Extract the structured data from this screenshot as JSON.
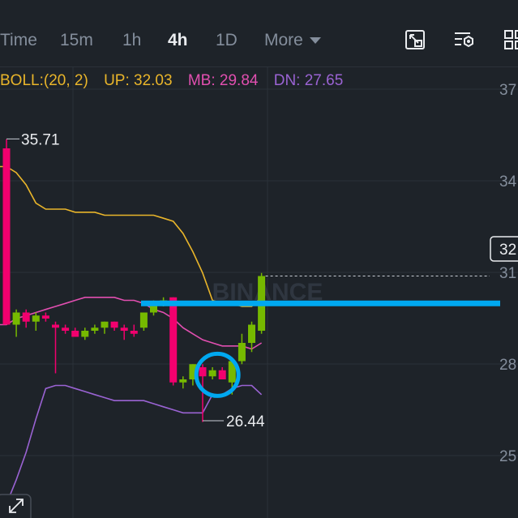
{
  "toolbar": {
    "timeframes": [
      "Time",
      "15m",
      "1h",
      "4h",
      "1D"
    ],
    "active": "4h",
    "more_label": "More",
    "tools": [
      "fullscreen-icon",
      "indicator-settings-icon",
      "layout-grid-icon"
    ]
  },
  "indicator": {
    "name": "BOLL:(20, 2)",
    "up": "UP: 32.03",
    "mb": "MB: 29.84",
    "dn": "DN: 27.65"
  },
  "colors": {
    "background": "#1e2329",
    "up_candle": "#76b900",
    "down_candle": "#f2006e",
    "upper_band": "#e9b52a",
    "middle_band": "#e14fb0",
    "lower_band": "#9a63d3",
    "annotation_line": "#00a8f0",
    "axis_text": "#848e9c"
  },
  "chart_data": {
    "type": "candlestick",
    "watermark": "BINANCE",
    "y_axis_labels": [
      "37",
      "34",
      "31",
      "28",
      "25"
    ],
    "current_price_label": "32",
    "high_marker": "35.71",
    "low_marker": "26.44",
    "candles": [
      {
        "o": 35.4,
        "h": 35.7,
        "l": 29.6,
        "c": 29.6
      },
      {
        "o": 29.6,
        "h": 30.1,
        "l": 29.2,
        "c": 30.0
      },
      {
        "o": 30.0,
        "h": 30.1,
        "l": 29.5,
        "c": 29.7
      },
      {
        "o": 29.7,
        "h": 30.0,
        "l": 29.4,
        "c": 29.9
      },
      {
        "o": 29.9,
        "h": 30.0,
        "l": 29.7,
        "c": 29.8
      },
      {
        "o": 29.6,
        "h": 29.7,
        "l": 28.0,
        "c": 29.5
      },
      {
        "o": 29.5,
        "h": 29.6,
        "l": 29.3,
        "c": 29.4
      },
      {
        "o": 29.4,
        "h": 29.5,
        "l": 29.2,
        "c": 29.2
      },
      {
        "o": 29.2,
        "h": 29.5,
        "l": 29.1,
        "c": 29.4
      },
      {
        "o": 29.4,
        "h": 29.6,
        "l": 29.3,
        "c": 29.5
      },
      {
        "o": 29.5,
        "h": 29.7,
        "l": 29.3,
        "c": 29.7
      },
      {
        "o": 29.7,
        "h": 29.7,
        "l": 29.4,
        "c": 29.5
      },
      {
        "o": 29.5,
        "h": 29.6,
        "l": 29.1,
        "c": 29.4
      },
      {
        "o": 29.4,
        "h": 29.6,
        "l": 29.2,
        "c": 29.3
      },
      {
        "o": 29.5,
        "h": 30.0,
        "l": 29.4,
        "c": 30.0
      },
      {
        "o": 30.0,
        "h": 30.4,
        "l": 29.9,
        "c": 30.3
      },
      {
        "o": 30.3,
        "h": 30.5,
        "l": 30.2,
        "c": 30.4
      },
      {
        "o": 30.5,
        "h": 30.5,
        "l": 27.6,
        "c": 27.7
      },
      {
        "o": 27.7,
        "h": 27.9,
        "l": 27.5,
        "c": 27.8
      },
      {
        "o": 27.8,
        "h": 28.3,
        "l": 27.6,
        "c": 28.3
      },
      {
        "o": 28.2,
        "h": 28.3,
        "l": 26.4,
        "c": 27.9
      },
      {
        "o": 27.9,
        "h": 28.2,
        "l": 27.8,
        "c": 28.1
      },
      {
        "o": 28.1,
        "h": 28.2,
        "l": 27.8,
        "c": 27.8
      },
      {
        "o": 27.7,
        "h": 28.4,
        "l": 27.3,
        "c": 28.4
      },
      {
        "o": 28.4,
        "h": 29.3,
        "l": 28.3,
        "c": 29.0
      },
      {
        "o": 29.0,
        "h": 29.7,
        "l": 28.7,
        "c": 29.6
      },
      {
        "o": 29.4,
        "h": 31.3,
        "l": 29.3,
        "c": 31.2
      }
    ],
    "bollinger": {
      "upper": [
        34.8,
        34.6,
        34.2,
        33.6,
        33.4,
        33.4,
        33.4,
        33.3,
        33.3,
        33.3,
        33.2,
        33.2,
        33.2,
        33.2,
        33.2,
        33.2,
        33.1,
        33.0,
        32.6,
        32.0,
        31.3,
        30.4,
        30.3,
        30.3,
        30.2,
        30.2,
        30.5
      ],
      "middle": [
        29.6,
        29.8,
        29.9,
        30.0,
        30.1,
        30.2,
        30.3,
        30.4,
        30.5,
        30.5,
        30.5,
        30.5,
        30.4,
        30.4,
        30.3,
        30.1,
        30.0,
        29.8,
        29.5,
        29.3,
        29.1,
        29.0,
        28.9,
        28.9,
        28.9,
        28.8,
        29.0
      ],
      "lower": [
        23.7,
        24.5,
        25.4,
        26.5,
        27.5,
        27.6,
        27.6,
        27.5,
        27.4,
        27.3,
        27.2,
        27.1,
        27.1,
        27.1,
        27.1,
        27.0,
        26.9,
        26.8,
        26.7,
        26.7,
        26.7,
        27.3,
        27.3,
        27.5,
        27.6,
        27.6,
        27.3
      ]
    },
    "annotations": {
      "horizontal_line": 30.3,
      "circled_candles": [
        21,
        22
      ]
    }
  }
}
